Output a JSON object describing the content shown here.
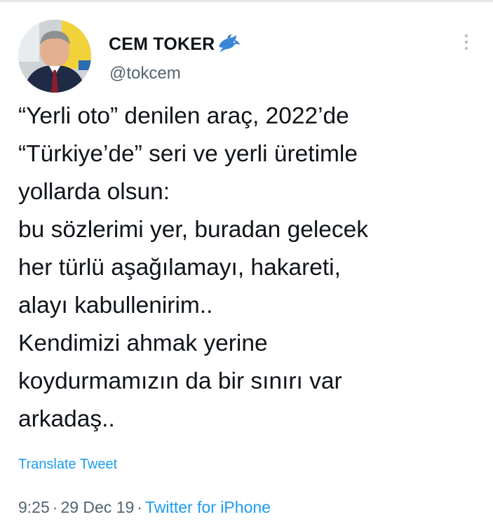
{
  "author": {
    "display_name": "CEM TOKER",
    "handle": "@tokcem",
    "badge_icon": "dolphin-icon",
    "avatar_alt": "profile-photo"
  },
  "tweet": {
    "lines": [
      "“Yerli oto” denilen araç, 2022’de",
      "“Türkiye’de” seri ve yerli üretimle",
      "yollarda olsun:",
      "bu sözlerimi yer, buradan gelecek",
      "her türlü aşağılamayı, hakareti,",
      "alayı kabullenirim..",
      "Kendimizi ahmak yerine",
      "koydurmamızın da bir sınırı var",
      "arkadaş.."
    ],
    "translate_label": "Translate Tweet"
  },
  "meta": {
    "time": "9:25",
    "separator": "·",
    "date": "29 Dec 19",
    "source": "Twitter for iPhone"
  },
  "colors": {
    "text": "#0f1419",
    "secondary": "#536471",
    "link": "#1d9bf0",
    "badge": "#3a86d6"
  }
}
